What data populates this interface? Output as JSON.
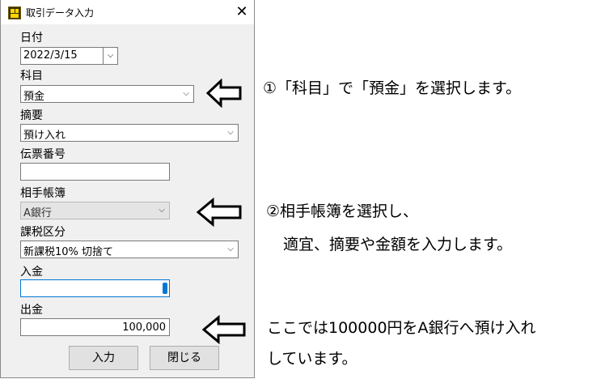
{
  "window": {
    "title": "取引データ入力",
    "close_glyph": "✕"
  },
  "form": {
    "date": {
      "label": "日付",
      "value": "2022/3/15"
    },
    "account": {
      "label": "科目",
      "value": "預金"
    },
    "summary": {
      "label": "摘要",
      "value": "預け入れ"
    },
    "slip_number": {
      "label": "伝票番号",
      "value": ""
    },
    "counter_ledger": {
      "label": "相手帳簿",
      "value": "A銀行"
    },
    "tax_category": {
      "label": "課税区分",
      "value": "新課税10% 切捨て"
    },
    "deposit": {
      "label": "入金",
      "value": ""
    },
    "withdrawal": {
      "label": "出金",
      "value": "100,000"
    }
  },
  "buttons": {
    "enter": "入力",
    "close": "閉じる"
  },
  "annotations": {
    "note1": "①「科目」で「預金」を選択します。",
    "note2_line1": "②相手帳簿を選択し、",
    "note2_line2": "適宜、摘要や金額を入力します。",
    "note3_line1": "ここでは100000円をA銀行へ預け入れ",
    "note3_line2": "しています。"
  },
  "icons": {
    "dropdown": "chevron-down-icon",
    "pointer": "left-arrow-icon"
  }
}
